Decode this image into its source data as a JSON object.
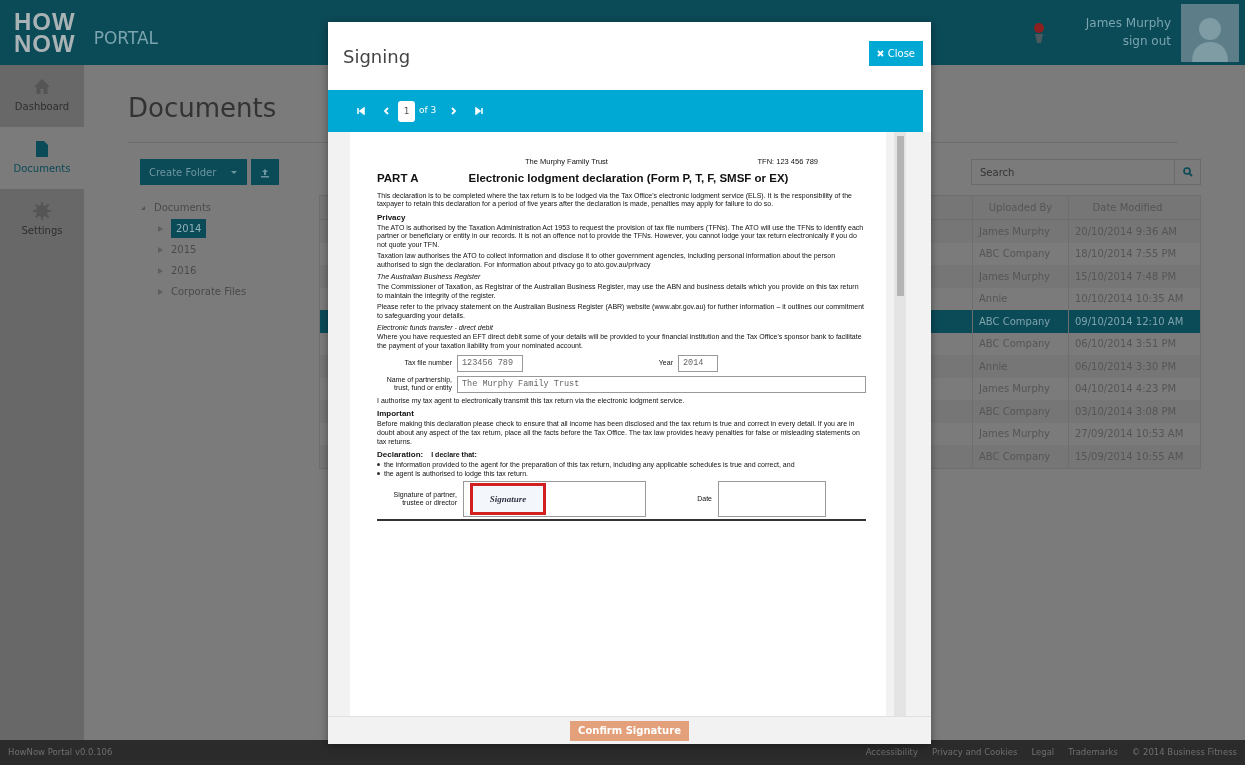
{
  "header": {
    "logo_lines": [
      "HOW",
      "NOW"
    ],
    "portal": "PORTAL",
    "user_name": "James Murphy",
    "sign_out": "sign out"
  },
  "sidebar": {
    "items": [
      {
        "label": "Dashboard",
        "kind": "home",
        "selected": false
      },
      {
        "label": "Documents",
        "kind": "document",
        "selected": true
      },
      {
        "label": "Settings",
        "kind": "gear",
        "selected": false
      }
    ]
  },
  "page_title": "Documents",
  "toolbar": {
    "create_folder": "Create Folder"
  },
  "tree": {
    "label": "Documents",
    "expanded": true,
    "children": [
      {
        "label": "2014",
        "selected": true
      },
      {
        "label": "2015",
        "selected": false
      },
      {
        "label": "2016",
        "selected": false
      },
      {
        "label": "Corporate Files",
        "selected": false
      }
    ]
  },
  "search": {
    "placeholder": "Search"
  },
  "table": {
    "columns": [
      "Uploaded By",
      "Date Modified"
    ],
    "rows": [
      {
        "cells": [
          "James Murphy",
          "20/10/2014 9:36 AM"
        ],
        "selected": false
      },
      {
        "cells": [
          "ABC Company",
          "18/10/2014 7:55 PM"
        ],
        "selected": false
      },
      {
        "cells": [
          "James Murphy",
          "15/10/2014 7:48 PM"
        ],
        "selected": false
      },
      {
        "cells": [
          "Annie",
          "10/10/2014 10:35 AM"
        ],
        "selected": false
      },
      {
        "cells": [
          "ABC Company",
          "09/10/2014 12:10 AM"
        ],
        "selected": true
      },
      {
        "cells": [
          "ABC Company",
          "06/10/2014 3:51 PM"
        ],
        "selected": false
      },
      {
        "cells": [
          "Annie",
          "06/10/2014 3:30 PM"
        ],
        "selected": false
      },
      {
        "cells": [
          "James Murphy",
          "04/10/2014 4:23 PM"
        ],
        "selected": false
      },
      {
        "cells": [
          "ABC Company",
          "03/10/2014 3:08 PM"
        ],
        "selected": false
      },
      {
        "cells": [
          "James Murphy",
          "27/09/2014 10:53 AM"
        ],
        "selected": false
      },
      {
        "cells": [
          "ABC Company",
          "15/09/2014 10:55 AM"
        ],
        "selected": false
      }
    ]
  },
  "modal": {
    "title": "Signing",
    "close": "Close",
    "page_input": "1",
    "page_of": "of 3",
    "confirm": "Confirm Signature",
    "confirm_disabled": true,
    "document": {
      "trust": "The Murphy Family Trust",
      "tfn": "TFN:  123 456 789",
      "part": "PART A",
      "title": "Electronic lodgment declaration (Form P, T, F, SMSF or EX)",
      "blocks": [
        {
          "kind": "para",
          "text": "This declaration is to be completed where the tax return is to be lodged via the Tax Office's electronic lodgment service (ELS). It is the responsibility of the taxpayer to retain this declaration for a period of five years after the declaration is made, penalties may apply for failure to do so."
        },
        {
          "kind": "subhead",
          "text": "Privacy"
        },
        {
          "kind": "para",
          "text": "The ATO is authorised by the Taxation Administration Act 1953 to request the provision of tax file numbers (TFNs).  The ATO will use the TFNs to identify each partner or beneficiary or entity in our records.  It is not an offence not to provide the TFNs. However, you cannot lodge your tax return electronically if you do not quote your TFN."
        },
        {
          "kind": "para",
          "text": "Taxation law authorises the ATO to collect information and disclose it to other government agencies, including personal information about the person authorised to sign the declaration.  For information about privacy go to ato.gov.au/privacy"
        },
        {
          "kind": "caption",
          "text": "The Australian Business Register"
        },
        {
          "kind": "para",
          "text": "The Commissioner of Taxation, as Registrar of the Australian Business Register, may use the ABN and business details which you provide on this tax return to maintain the integrity of the register."
        },
        {
          "kind": "para",
          "text": "Please refer to the privacy statement on the Australian Business Register (ABR) website (www.abr.gov.au) for further information – it outlines our commitment to safeguarding your details."
        },
        {
          "kind": "caption",
          "text": "Electronic funds transfer - direct debit"
        },
        {
          "kind": "para",
          "text": "Where you have requested an EFT direct debit some of your details will be provided to your financial institution and the Tax Office's sponsor bank to facilitate the payment of your taxation liability from your nominated account."
        }
      ],
      "tfn_label": "Tax file number",
      "tfn_value": "123456  789",
      "year_label": "Year",
      "year_value": "2014",
      "entity_label": "Name of partnership, trust, fund or entity",
      "entity_value": "The Murphy Family Trust",
      "blocks2": [
        {
          "kind": "para",
          "text": "I authorise my tax agent to electronically transmit this tax return via the electronic lodgment service."
        },
        {
          "kind": "subhead",
          "text": "Important"
        },
        {
          "kind": "para",
          "text": "Before making this declaration please check to ensure that all income has been disclosed and the tax return is true and correct in every detail.  If you are in doubt about any aspect of the tax return, place all the facts before the Tax Office. The tax law provides heavy penalties for false or misleading statements on tax returns."
        }
      ],
      "declaration": "Declaration:",
      "declare_that": "I declare that:",
      "bullets": [
        "the information provided to the agent for the preparation of this tax return, including any applicable schedules is true and correct, and",
        "the agent is authorised to lodge this tax return."
      ],
      "signature_label": "Signature of partner, trustee or director",
      "signature_stamp": "Signature",
      "date_label": "Date"
    }
  },
  "footer": {
    "version": "HowNow Portal v0.0.106",
    "links": [
      "Accessibility",
      "Privacy and Cookies",
      "Legal",
      "Trademarks",
      "© 2014 Business Fitness"
    ]
  }
}
